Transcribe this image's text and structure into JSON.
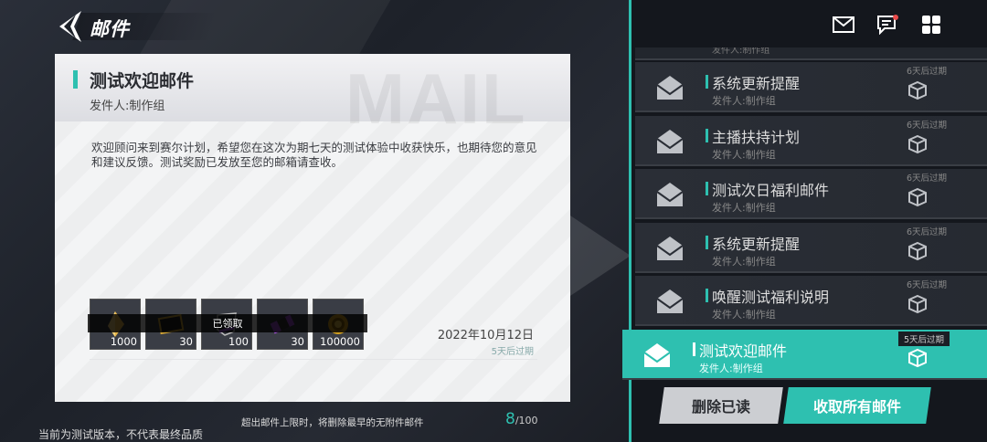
{
  "header": {
    "title": "邮件"
  },
  "top_icons": [
    "mail-icon",
    "chat-icon",
    "grid-menu-icon"
  ],
  "detail": {
    "subject": "测试欢迎邮件",
    "sender": "发件人:制作组",
    "watermark": "MAIL",
    "body": "欢迎顾问来到赛尔计划，希望您在这次为期七天的测试体验中收获快乐，也期待您的意见和建议反馈。测试奖励已发放至您的邮箱请查收。",
    "rewards": [
      {
        "icon": "crystal-icon",
        "qty": "1000"
      },
      {
        "icon": "card-icon",
        "qty": "30"
      },
      {
        "icon": "shield-icon",
        "qty": "100"
      },
      {
        "icon": "ticket-icon",
        "qty": "30"
      },
      {
        "icon": "coin-icon",
        "qty": "100000"
      }
    ],
    "claimed_label": "已领取",
    "date": "2022年10月12日",
    "expire": "5天后过期"
  },
  "footer": {
    "limit_note": "超出邮件上限时，将删除最早的无附件邮件",
    "count_current": "8",
    "count_total": "/100",
    "version_note": "当前为测试版本，不代表最终品质"
  },
  "mail_list": {
    "top_partial_sender": "发件人:制作组",
    "items": [
      {
        "subject": "系统更新提醒",
        "sender": "发件人:制作组",
        "expire": "6天后过期",
        "active": false
      },
      {
        "subject": "主播扶持计划",
        "sender": "发件人:制作组",
        "expire": "6天后过期",
        "active": false
      },
      {
        "subject": "测试次日福利邮件",
        "sender": "发件人:制作组",
        "expire": "6天后过期",
        "active": false
      },
      {
        "subject": "系统更新提醒",
        "sender": "发件人:制作组",
        "expire": "6天后过期",
        "active": false
      },
      {
        "subject": "唤醒测试福利说明",
        "sender": "发件人:制作组",
        "expire": "6天后过期",
        "active": false
      },
      {
        "subject": "测试欢迎邮件",
        "sender": "发件人:制作组",
        "expire": "5天后过期",
        "active": true
      }
    ]
  },
  "actions": {
    "delete_read": "删除已读",
    "claim_all": "收取所有邮件"
  },
  "colors": {
    "accent": "#2ec0b0",
    "panel_dark": "#14171d",
    "card_bg": "#f3f4f5"
  }
}
